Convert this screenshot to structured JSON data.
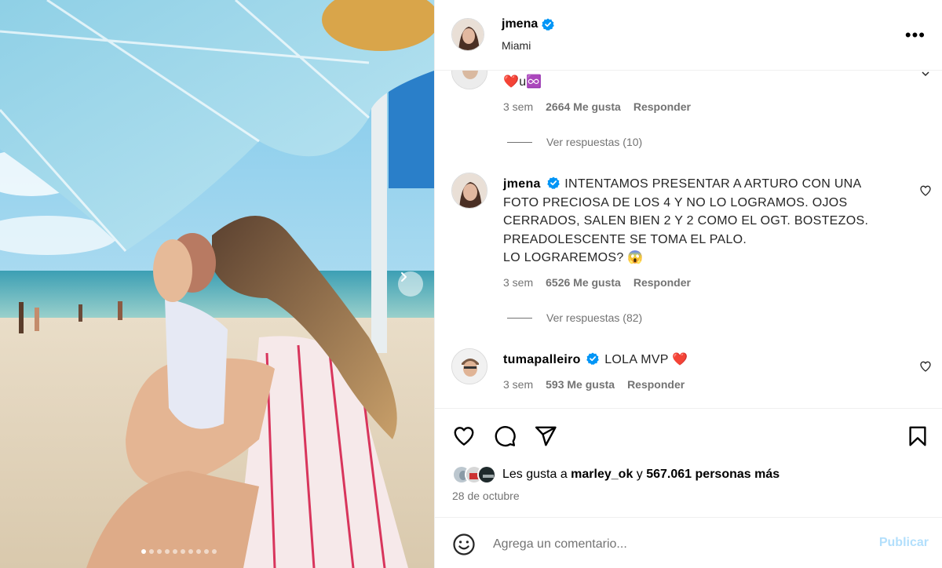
{
  "post": {
    "username": "jmena",
    "location": "Miami"
  },
  "comments": [
    {
      "username": "",
      "text": "❤️u♾️",
      "time": "3 sem",
      "likes": "2664 Me gusta",
      "reply_label": "Responder",
      "view_replies": "Ver respuestas (10)"
    },
    {
      "username": "jmena",
      "lines": [
        "INTENTAMOS PRESENTAR A ARTURO CON UNA",
        "FOTO PRECIOSA DE LOS 4 Y NO LO LOGRAMOS. OJOS",
        "CERRADOS, SALEN BIEN 2 Y 2 COMO EL OGT. BOSTEZOS.",
        "PREADOLESCENTE SE TOMA EL PALO.",
        "LO LOGRAREMOS? 😱"
      ],
      "time": "3 sem",
      "likes": "6526 Me gusta",
      "reply_label": "Responder",
      "view_replies": "Ver respuestas (82)"
    },
    {
      "username": "tumapalleiro",
      "text": "LOLA MVP ❤️",
      "time": "3 sem",
      "likes": "593 Me gusta",
      "reply_label": "Responder"
    }
  ],
  "likes_summary": {
    "prefix": "Les gusta a ",
    "user": "marley_ok",
    "connector": " y ",
    "count": "567.061 personas más"
  },
  "date": "28 de octubre",
  "add_comment": {
    "placeholder": "Agrega un comentario...",
    "publish_label": "Publicar"
  },
  "carousel": {
    "total_slides": 10,
    "active_index": 0
  },
  "colors": {
    "verified": "#0095f6",
    "heart": "#ed4956",
    "publish_disabled": "#b2dffc",
    "muted_text": "#737373"
  }
}
